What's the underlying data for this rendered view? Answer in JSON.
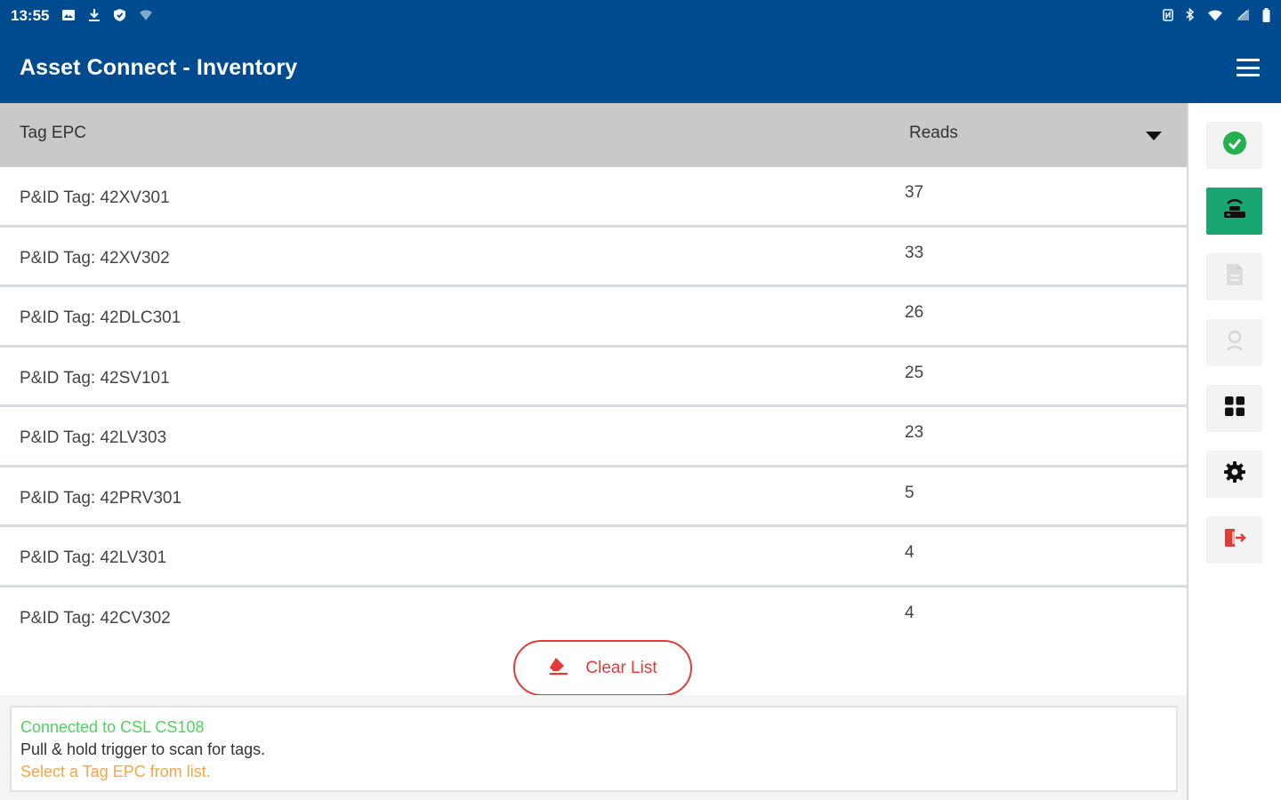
{
  "status_bar": {
    "time": "13:55",
    "left_icons": [
      "image-icon",
      "download-icon",
      "shield-icon",
      "wifi-off-icon"
    ],
    "right_icons": [
      "nfc-icon",
      "bluetooth-icon",
      "wifi-icon",
      "signal-icon",
      "battery-icon"
    ]
  },
  "app_bar": {
    "title": "Asset Connect - Inventory"
  },
  "table": {
    "header_epc": "Tag EPC",
    "header_reads": "Reads",
    "rows": [
      {
        "epc": "P&ID Tag: 42XV301",
        "reads": "37"
      },
      {
        "epc": "P&ID Tag: 42XV302",
        "reads": "33"
      },
      {
        "epc": "P&ID Tag: 42DLC301",
        "reads": "26"
      },
      {
        "epc": "P&ID Tag: 42SV101",
        "reads": "25"
      },
      {
        "epc": "P&ID Tag: 42LV303",
        "reads": "23"
      },
      {
        "epc": "P&ID Tag: 42PRV301",
        "reads": "5"
      },
      {
        "epc": "P&ID Tag: 42LV301",
        "reads": "4"
      },
      {
        "epc": "P&ID Tag: 42CV302",
        "reads": "4"
      }
    ]
  },
  "clear_button": {
    "label": "Clear List"
  },
  "status_messages": {
    "connected": "Connected to CSL CS108",
    "instruction": "Pull & hold trigger to scan for tags.",
    "hint": "Select a Tag EPC from list."
  },
  "sidebar": {
    "items": [
      "check-circle-icon",
      "rfid-reader-icon",
      "document-icon",
      "location-pin-icon",
      "grid-icon",
      "gear-icon",
      "exit-icon"
    ]
  },
  "colors": {
    "brand_blue": "#004a8f",
    "active_green": "#1aa672",
    "danger_red": "#e53935",
    "success_green": "#4cd45a",
    "hint_orange": "#f5a54a"
  }
}
